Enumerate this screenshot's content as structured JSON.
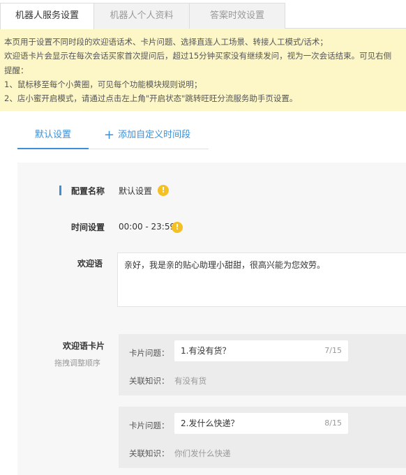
{
  "tabs": [
    {
      "label": "机器人服务设置",
      "active": true
    },
    {
      "label": "机器人个人资料",
      "active": false
    },
    {
      "label": "答案时效设置",
      "active": false
    }
  ],
  "notice": {
    "lines": [
      "本页用于设置不同时段的欢迎语话术、卡片问题、选择直连人工场景、转接人工模式/话术；",
      "欢迎语卡片会显示在每次会话买家首次提问后，超过15分钟买家没有继续发问，视为一次会话结束。可见右侧",
      "提醒：",
      "1、鼠标移至每个小黄圈，可见每个功能模块规则说明；",
      "2、店小蜜开启模式，请通过点击左上角\"开启状态\"跳转旺旺分流服务助手页设置。"
    ]
  },
  "subtabs": {
    "default_label": "默认设置",
    "add_label": "添加自定义时间段"
  },
  "config": {
    "name_label": "配置名称",
    "name_value": "默认设置",
    "time_label": "时间设置",
    "time_value": "00:00 - 23:59",
    "greeting_label": "欢迎语",
    "greeting_value": "亲好，我是亲的贴心助理小甜甜，很高兴能为您效劳。",
    "cards_label": "欢迎语卡片",
    "cards_hint": "拖拽调整顺序",
    "card_question_label": "卡片问题：",
    "card_knowledge_label": "关联知识：",
    "cards": [
      {
        "question": "1.有没有货？",
        "count": "7/15",
        "knowledge": "有没有货"
      },
      {
        "question": "2.发什么快递？",
        "count": "8/15",
        "knowledge": "你们发什么快递"
      }
    ]
  },
  "colors": {
    "accent": "#3b8fd9",
    "notice_bg": "#fdf7c8",
    "warn": "#f5c023",
    "panel_bg": "#f7f7f7"
  },
  "icons": {
    "warn": "!",
    "plus": "+"
  }
}
